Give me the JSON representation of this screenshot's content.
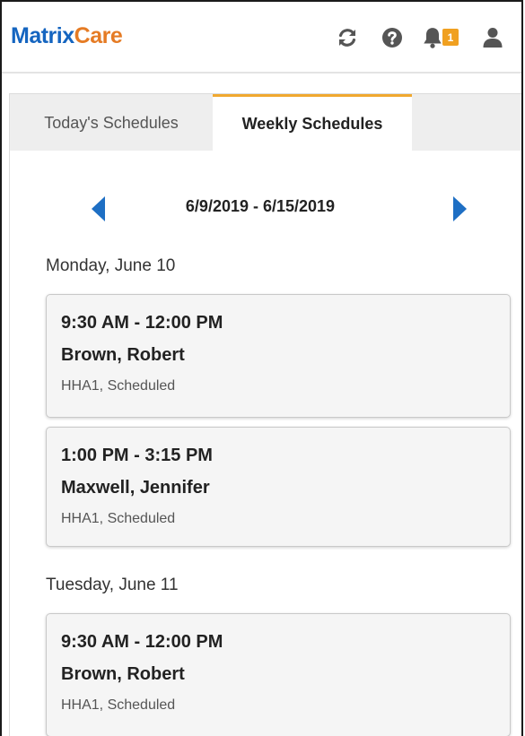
{
  "header": {
    "logo_part1": "Matrix",
    "logo_part2": "Care",
    "notification_count": "1",
    "icons": [
      "refresh-icon",
      "help-icon",
      "bell-icon",
      "user-icon"
    ],
    "brand_blue": "#1565c0",
    "brand_orange": "#e57b24",
    "badge_color": "#f0a020"
  },
  "tabs": [
    {
      "label": "Today's Schedules",
      "active": false
    },
    {
      "label": "Weekly Schedules",
      "active": true
    }
  ],
  "week": {
    "range": "6/9/2019 - 6/15/2019",
    "prev_icon": "chevron-left-icon",
    "next_icon": "chevron-right-icon",
    "arrow_color": "#1e6fc4"
  },
  "days": [
    {
      "heading": "Monday, June 10",
      "visits": [
        {
          "time": "9:30 AM - 12:00 PM",
          "client": "Brown, Robert",
          "status": "HHA1, Scheduled"
        },
        {
          "time": "1:00 PM - 3:15 PM",
          "client": "Maxwell, Jennifer",
          "status": "HHA1, Scheduled"
        }
      ]
    },
    {
      "heading": "Tuesday, June 11",
      "visits": [
        {
          "time": "9:30 AM - 12:00 PM",
          "client": "Brown, Robert",
          "status": "HHA1, Scheduled"
        }
      ]
    }
  ]
}
